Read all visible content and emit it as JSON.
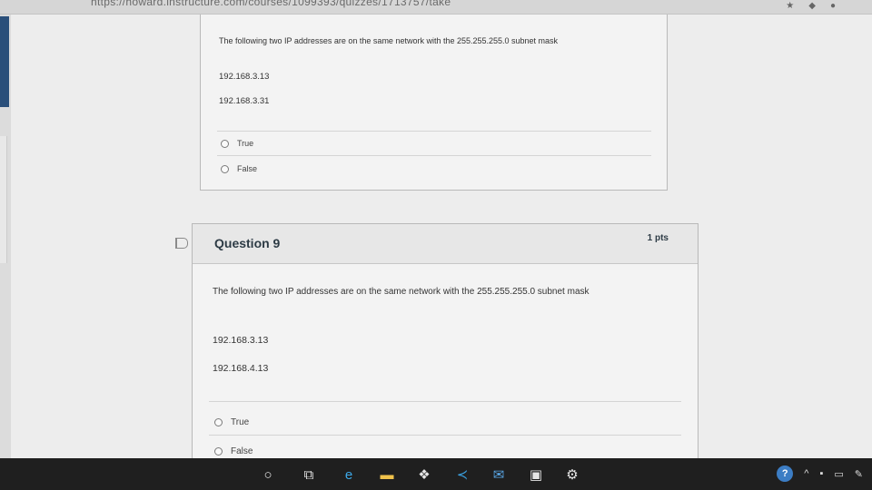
{
  "browser": {
    "url": "https://howard.instructure.com/courses/1099393/quizzes/1713757/take"
  },
  "question8": {
    "text": "The following two IP addresses are on the same network with the 255.255.255.0 subnet mask",
    "ip1": "192.168.3.13",
    "ip2": "192.168.3.31",
    "answers": [
      "True",
      "False"
    ]
  },
  "question9": {
    "title": "Question 9",
    "points": "1 pts",
    "text": "The following two IP addresses are on the same network with the 255.255.255.0 subnet mask",
    "ip1": "192.168.3.13",
    "ip2": "192.168.4.13",
    "answers": [
      "True",
      "False"
    ]
  },
  "taskbar": {
    "apps": [
      "search-icon",
      "task-view-icon",
      "edge-icon",
      "file-explorer-icon",
      "dropbox-icon",
      "vscode-icon",
      "mail-icon",
      "store-icon",
      "settings-icon"
    ],
    "help_icon_text": "?"
  }
}
